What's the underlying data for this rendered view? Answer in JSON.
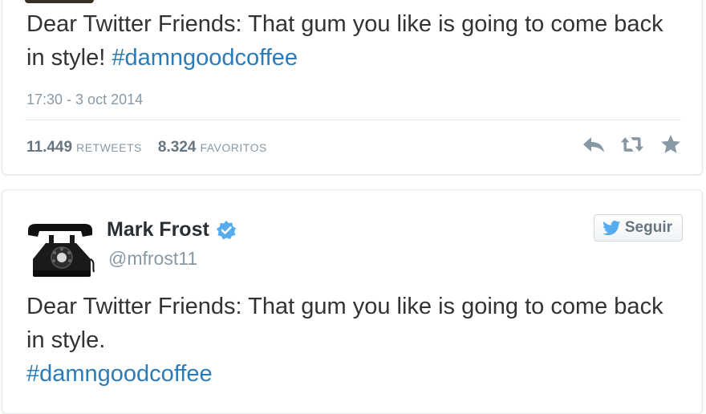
{
  "tweet1": {
    "text": "Dear Twitter Friends: That gum you like is going to come back in style! ",
    "hashtag": "#damngoodcoffee",
    "timestamp": "17:30 - 3 oct 2014",
    "retweets_count": "11.449",
    "retweets_label": "RETWEETS",
    "favorites_count": "8.324",
    "favorites_label": "FAVORITOS",
    "actions": [
      "reply-icon",
      "retweet-icon",
      "favorite-star-icon"
    ]
  },
  "tweet2": {
    "display_name": "Mark Frost",
    "handle": "@mfrost11",
    "follow_label": "Seguir",
    "text": "Dear Twitter Friends: That gum you like is going to come back in style.",
    "hashtag": "#damngoodcoffee"
  },
  "colors": {
    "hashtag": "#2b7bb9",
    "verified": "#55acee",
    "muted": "#8899a6",
    "text": "#333333"
  },
  "icons": {
    "avatar": "rotary-telephone",
    "verified": "verified-badge-icon",
    "follow": "twitter-bird-icon"
  }
}
